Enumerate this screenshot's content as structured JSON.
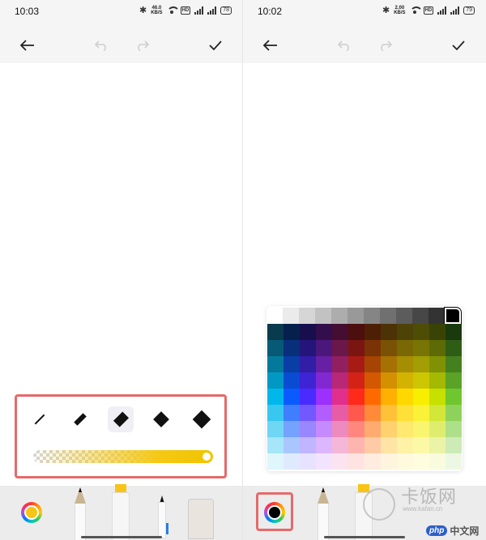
{
  "left": {
    "status": {
      "time": "10:03",
      "speed_value": "46.0",
      "speed_unit": "KB/S",
      "hd": "HD",
      "net1": "4G",
      "net2": "5G",
      "battery": "78"
    },
    "stroke_sizes": [
      "size-1",
      "size-2",
      "size-3",
      "size-4",
      "size-5"
    ],
    "selected_size_index": 2,
    "opacity": 1.0,
    "active_color": "#f5c518"
  },
  "right": {
    "status": {
      "time": "10:02",
      "speed_value": "2.00",
      "speed_unit": "KB/S",
      "hd": "HD",
      "net1": "4G",
      "net2": "5G",
      "battery": "79"
    },
    "active_color": "#000000",
    "palette": {
      "grays": [
        "#ffffff",
        "#ebebeb",
        "#d6d6d6",
        "#c2c2c2",
        "#adadad",
        "#999999",
        "#858585",
        "#707070",
        "#5c5c5c",
        "#474747",
        "#333333",
        "#000000"
      ],
      "hues": [
        "#0e6b8c",
        "#0a3b8c",
        "#2b1a8c",
        "#5a1a8c",
        "#7a1a5a",
        "#8c1a1a",
        "#8c3a0a",
        "#8c5a0a",
        "#8c7a0a",
        "#8c8c0a",
        "#6a7a0a",
        "#2f6a1a"
      ]
    }
  },
  "watermark": {
    "cn": "卡饭网",
    "url": "www.kafan.cn",
    "php": "php",
    "php_cn": "中文网"
  },
  "colors": {
    "highlight_border": "#e46a6a",
    "marker_yellow": "#f8c517",
    "pen_blue": "#2d7de0"
  }
}
